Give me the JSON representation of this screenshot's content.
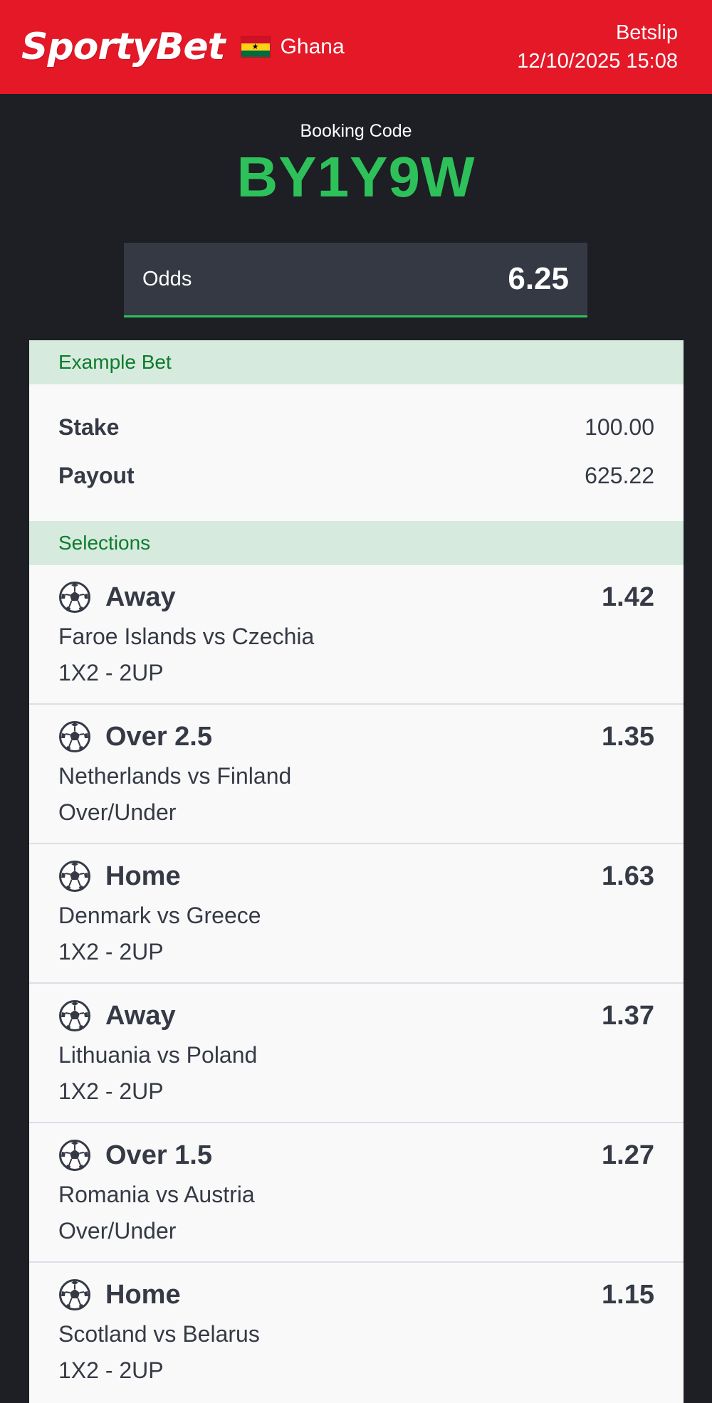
{
  "header": {
    "logo": "SportyBet",
    "country": "Ghana",
    "flag_colors": [
      "#ce1126",
      "#fcd116",
      "#006b3f"
    ],
    "title": "Betslip",
    "datetime": "12/10/2025 15:08",
    "background": "#e41827"
  },
  "booking": {
    "label": "Booking Code",
    "code": "BY1Y9W",
    "code_color": "#2ec15a"
  },
  "odds": {
    "label": "Odds",
    "value": "6.25"
  },
  "example_bet": {
    "heading": "Example Bet",
    "stake_label": "Stake",
    "stake_value": "100.00",
    "payout_label": "Payout",
    "payout_value": "625.22"
  },
  "selections": {
    "heading": "Selections",
    "icon": "soccer-ball-icon",
    "items": [
      {
        "pick": "Away",
        "match": "Faroe Islands vs Czechia",
        "market": "1X2 - 2UP",
        "odd": "1.42"
      },
      {
        "pick": "Over 2.5",
        "match": "Netherlands vs Finland",
        "market": "Over/Under",
        "odd": "1.35"
      },
      {
        "pick": "Home",
        "match": "Denmark vs Greece",
        "market": "1X2 - 2UP",
        "odd": "1.63"
      },
      {
        "pick": "Away",
        "match": "Lithuania vs Poland",
        "market": "1X2 - 2UP",
        "odd": "1.37"
      },
      {
        "pick": "Over 1.5",
        "match": "Romania vs Austria",
        "market": "Over/Under",
        "odd": "1.27"
      },
      {
        "pick": "Home",
        "match": "Scotland vs Belarus",
        "market": "1X2 - 2UP",
        "odd": "1.15"
      }
    ]
  }
}
